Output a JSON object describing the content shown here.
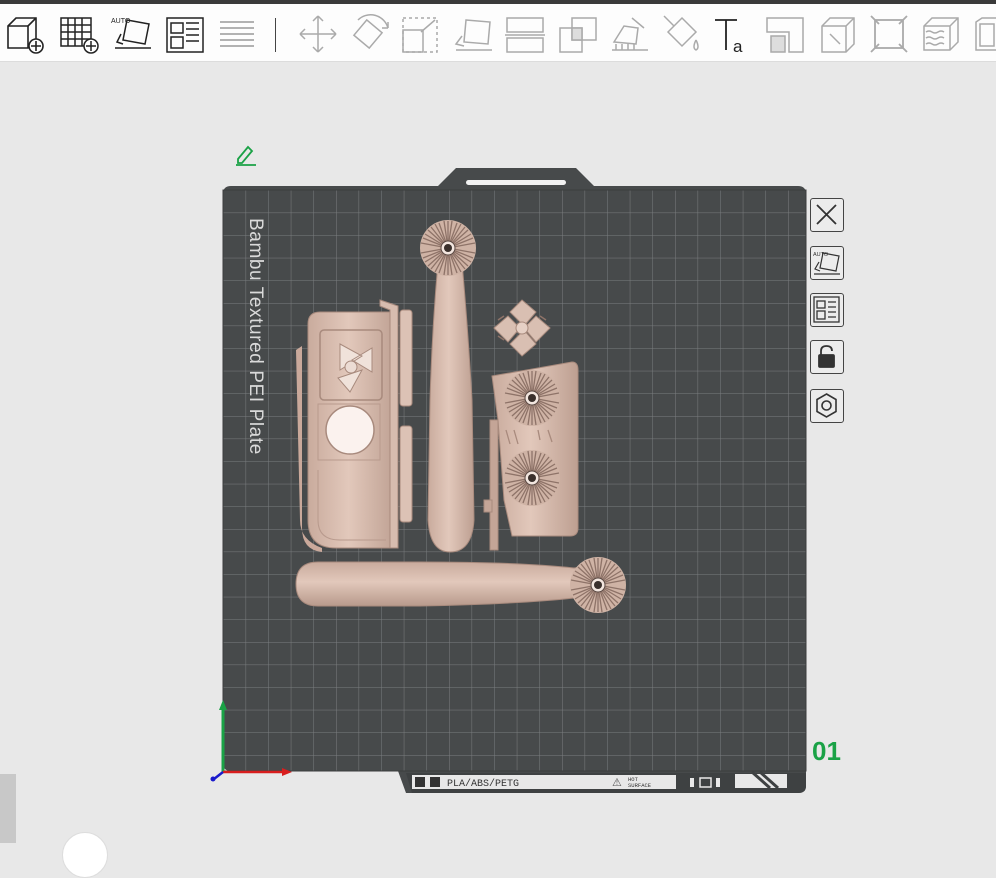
{
  "toolbar": {
    "buttons": [
      {
        "id": "add",
        "icon": "add-object-icon",
        "enabled": true
      },
      {
        "id": "add-plate",
        "icon": "add-plate-icon",
        "enabled": true
      },
      {
        "id": "auto-orient",
        "icon": "auto-orient-icon",
        "label": "AUTO",
        "enabled": true
      },
      {
        "id": "arrange",
        "icon": "arrange-icon",
        "enabled": true
      },
      {
        "id": "split",
        "icon": "split-layers-icon",
        "enabled": false
      },
      {
        "id": "move",
        "icon": "move-icon",
        "enabled": false
      },
      {
        "id": "rotate",
        "icon": "rotate-icon",
        "enabled": false
      },
      {
        "id": "scale",
        "icon": "scale-icon",
        "enabled": false
      },
      {
        "id": "lay-on-face",
        "icon": "lay-on-face-icon",
        "enabled": false
      },
      {
        "id": "cut",
        "icon": "cut-icon",
        "enabled": false
      },
      {
        "id": "boolean",
        "icon": "boolean-icon",
        "enabled": false
      },
      {
        "id": "support-paint",
        "icon": "support-paint-icon",
        "enabled": false
      },
      {
        "id": "color-paint",
        "icon": "color-paint-icon",
        "enabled": false
      },
      {
        "id": "text",
        "icon": "text-icon",
        "enabled": true
      },
      {
        "id": "seam",
        "icon": "seam-paint-icon",
        "enabled": false
      },
      {
        "id": "measure",
        "icon": "measure-icon",
        "enabled": false
      },
      {
        "id": "assembly",
        "icon": "assembly-icon",
        "enabled": false
      },
      {
        "id": "fuzzy-skin",
        "icon": "fuzzy-skin-icon",
        "enabled": false
      },
      {
        "id": "more",
        "icon": "more-icon",
        "enabled": false
      }
    ]
  },
  "plate": {
    "name_vertical": "Bambu Textured PEI Plate",
    "number": "01",
    "label_filament": "PLA/ABS/PETG",
    "label_hot": "HOT",
    "label_surface": "SURFACE",
    "bed_color": "#474a4b",
    "grid_color": "#7b7e80",
    "model_color": "#d4b8aa"
  },
  "plate_controls": [
    {
      "id": "close",
      "icon": "close-icon"
    },
    {
      "id": "auto-orient-plate",
      "icon": "auto-orient-icon",
      "label": "AUTO"
    },
    {
      "id": "arrange-plate",
      "icon": "arrange-icon"
    },
    {
      "id": "lock-plate",
      "icon": "lock-icon"
    },
    {
      "id": "plate-settings",
      "icon": "settings-icon"
    }
  ],
  "axes": {
    "x_color": "#d81e1e",
    "y_color": "#1aa246",
    "z_color": "#1a1acc"
  },
  "accent": "#1aa246"
}
